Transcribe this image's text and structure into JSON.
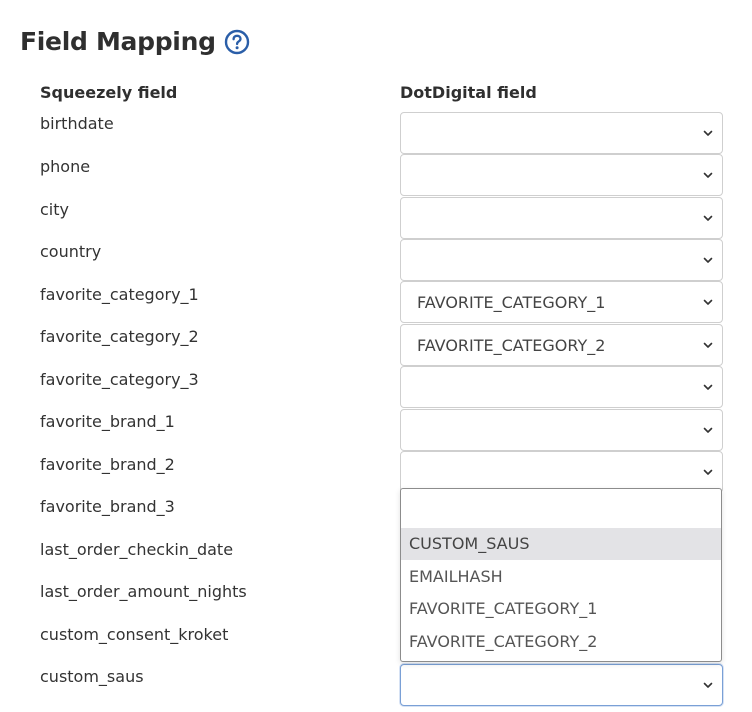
{
  "section": {
    "title": "Field Mapping",
    "help_icon": "question-circle-icon",
    "accent_color": "#2a5ea8"
  },
  "columns": {
    "left": "Squeezely field",
    "right": "DotDigital field"
  },
  "rows": [
    {
      "field": "birthdate",
      "value": ""
    },
    {
      "field": "phone",
      "value": ""
    },
    {
      "field": "city",
      "value": ""
    },
    {
      "field": "country",
      "value": ""
    },
    {
      "field": "favorite_category_1",
      "value": "FAVORITE_CATEGORY_1"
    },
    {
      "field": "favorite_category_2",
      "value": "FAVORITE_CATEGORY_2"
    },
    {
      "field": "favorite_category_3",
      "value": ""
    },
    {
      "field": "favorite_brand_1",
      "value": ""
    },
    {
      "field": "favorite_brand_2",
      "value": ""
    },
    {
      "field": "favorite_brand_3",
      "value": ""
    },
    {
      "field": "last_order_checkin_date",
      "value": ""
    },
    {
      "field": "last_order_amount_nights",
      "value": ""
    },
    {
      "field": "custom_consent_kroket",
      "value": ""
    },
    {
      "field": "custom_saus",
      "value": ""
    }
  ],
  "dropdown": {
    "search_value": "",
    "options": [
      "CUSTOM_SAUS",
      "EMAILHASH",
      "FAVORITE_CATEGORY_1",
      "FAVORITE_CATEGORY_2"
    ],
    "highlighted_index": 0
  }
}
